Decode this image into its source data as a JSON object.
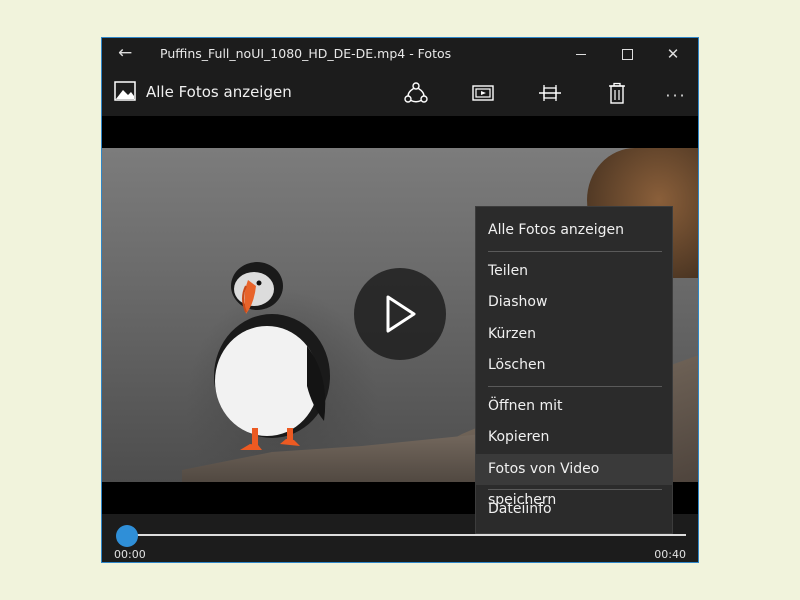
{
  "window": {
    "title": "Puffins_Full_noUI_1080_HD_DE-DE.mp4 - Fotos",
    "accent": "#2f86c9"
  },
  "titlebar": {
    "back_icon": "back-arrow-icon",
    "minimize_icon": "minimize-icon",
    "maximize_icon": "maximize-icon",
    "close_icon": "close-icon"
  },
  "commandbar": {
    "all_photos_label": "Alle Fotos anzeigen",
    "icons": [
      "photos-icon",
      "share-icon",
      "slideshow-icon",
      "trim-icon",
      "delete-icon",
      "more-icon"
    ],
    "more_glyph": "···"
  },
  "player": {
    "time_start": "00:00",
    "time_end": "00:40",
    "progress": 0,
    "thumb_color": "#2f8fd8"
  },
  "context_menu": {
    "items": [
      "Alle Fotos anzeigen",
      "Teilen",
      "Diashow",
      "Kürzen",
      "Löschen",
      "Öffnen mit",
      "Kopieren",
      "Fotos von Video speichern",
      "Dateiinfo"
    ],
    "highlighted": "Fotos von Video speichern"
  }
}
